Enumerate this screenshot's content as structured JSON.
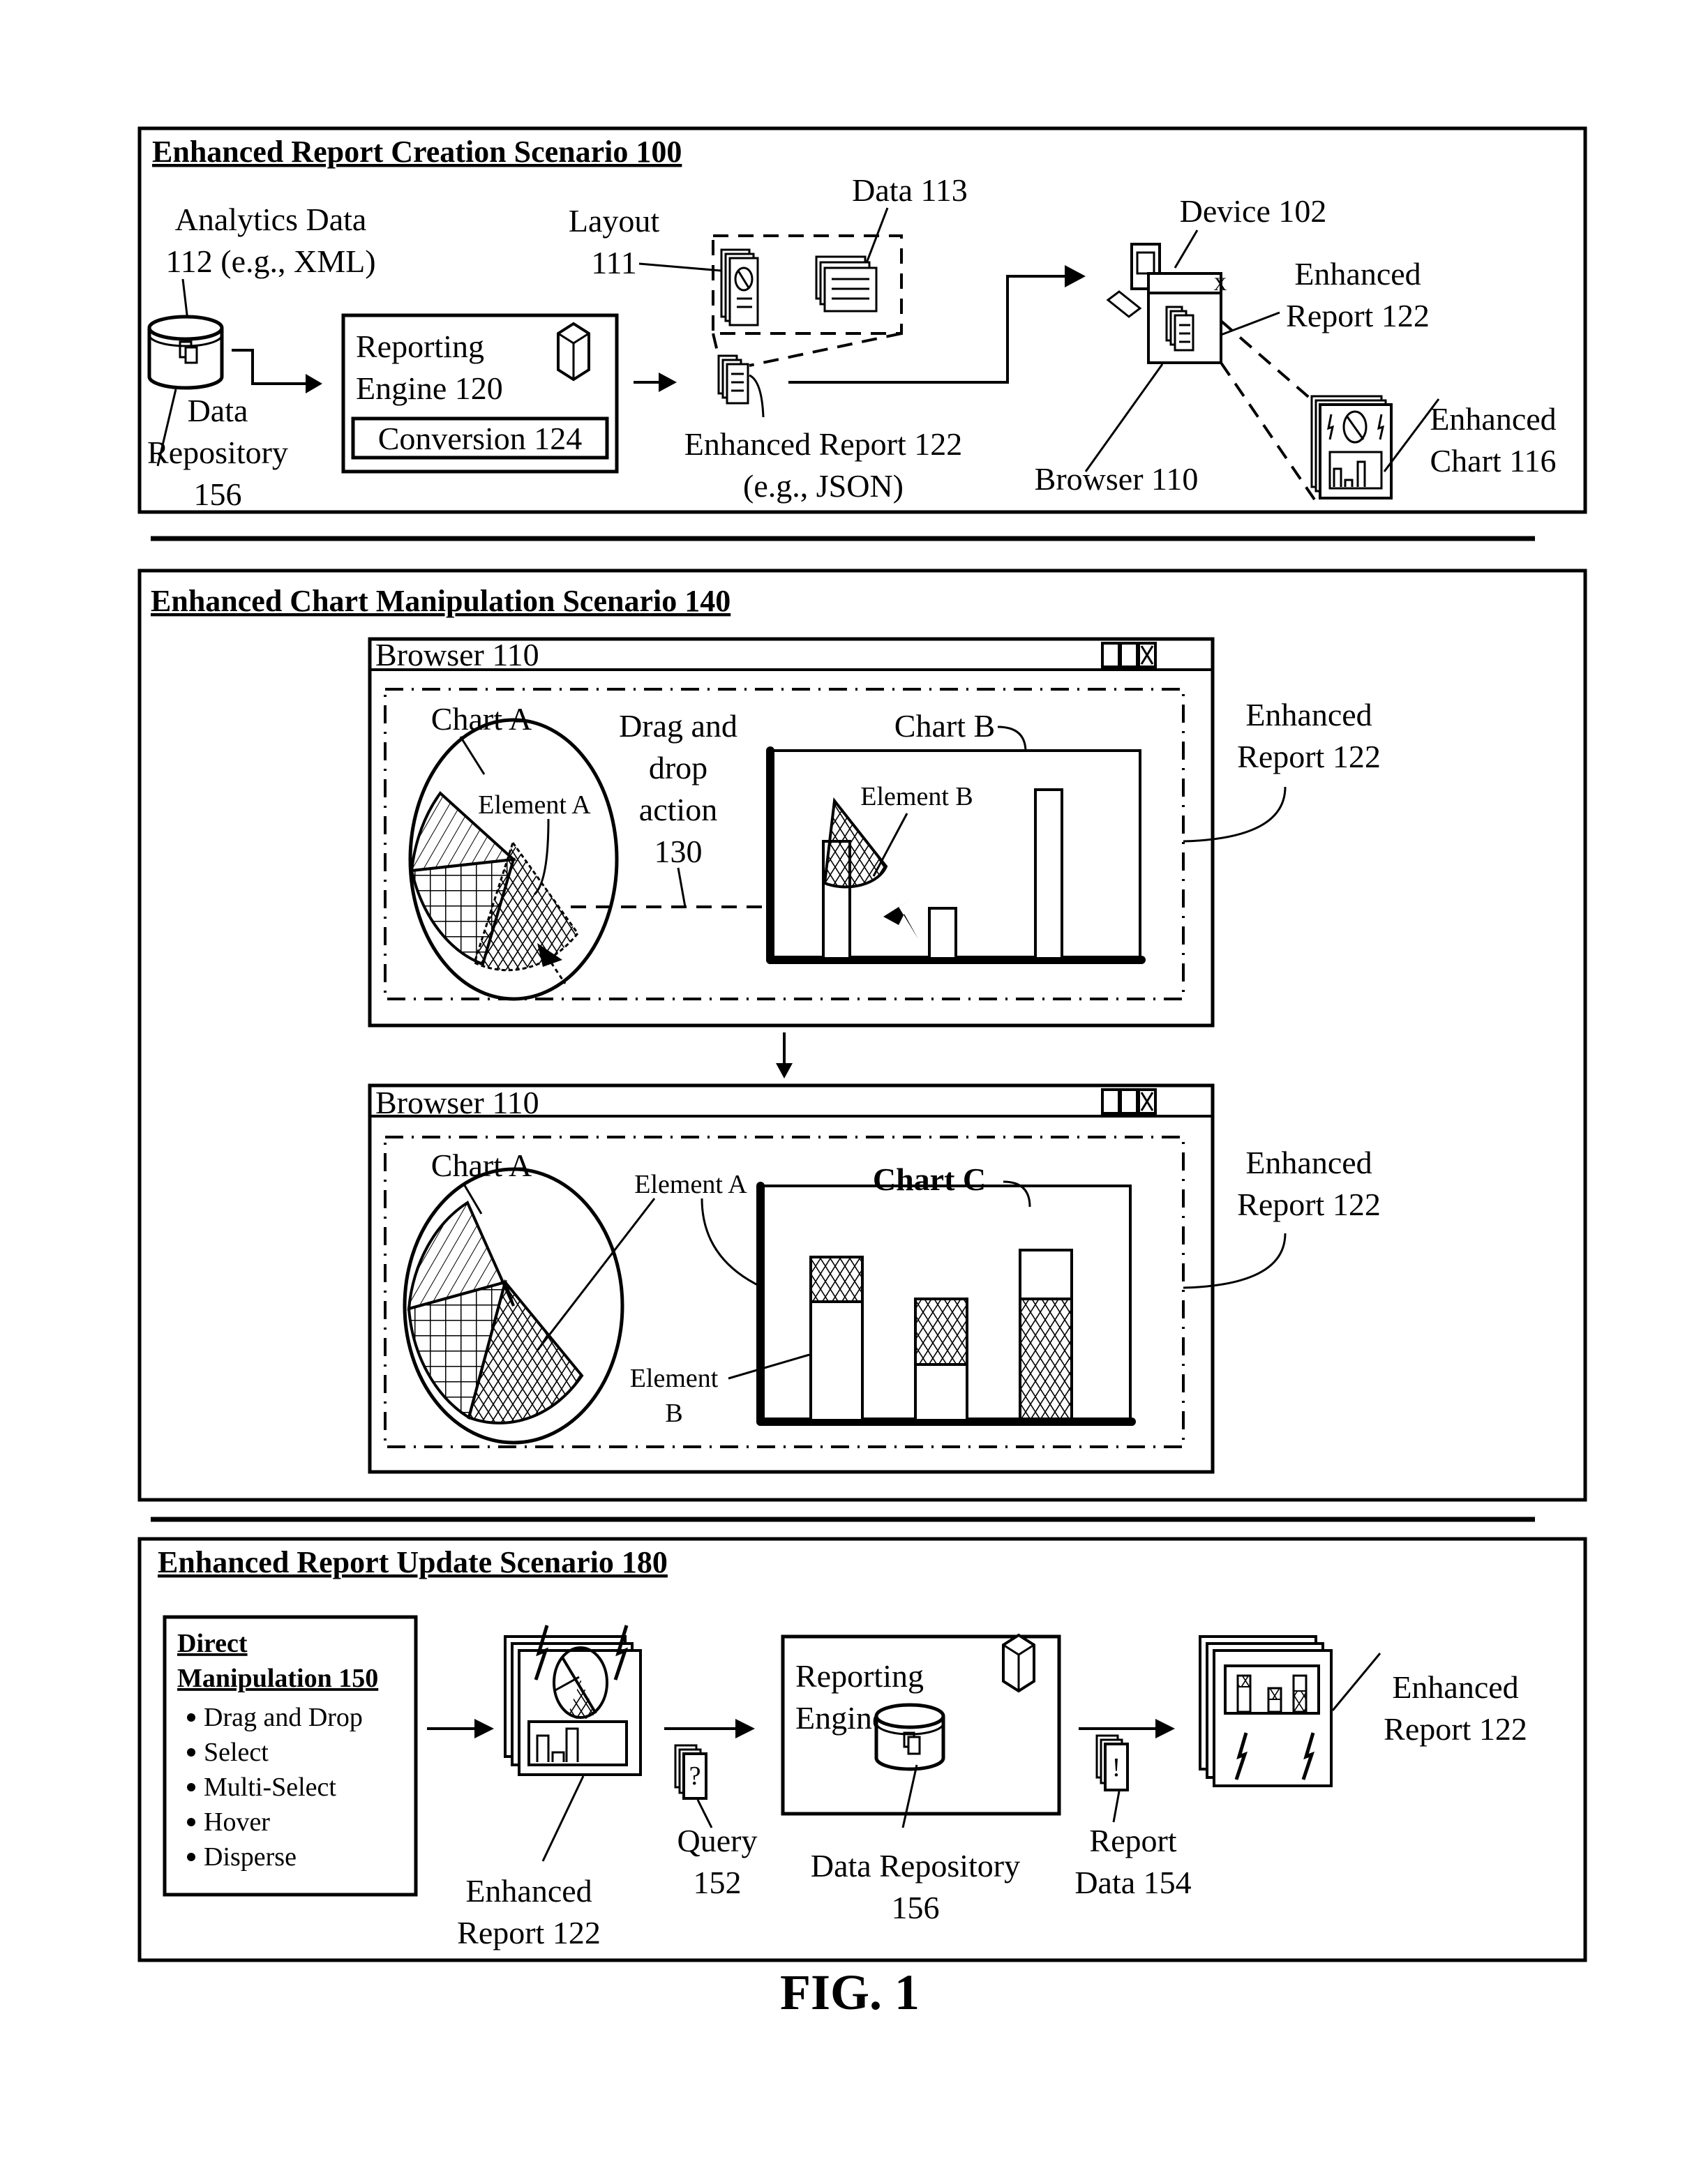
{
  "figure_label": "FIG. 1",
  "panel_creation": {
    "title": "Enhanced Report Creation Scenario 100",
    "analytics_data": [
      "Analytics Data",
      "112 (e.g., XML)"
    ],
    "data_repository": [
      "Data",
      "Repository",
      "156"
    ],
    "reporting_engine": [
      "Reporting",
      "Engine 120"
    ],
    "conversion": "Conversion 124",
    "layout": [
      "Layout",
      "111"
    ],
    "data_113": "Data 113",
    "enhanced_report": [
      "Enhanced Report 122",
      "(e.g., JSON)"
    ],
    "device": "Device 102",
    "enhanced_report_right": [
      "Enhanced",
      "Report 122"
    ],
    "browser": "Browser 110",
    "enhanced_chart": [
      "Enhanced",
      "Chart 116"
    ],
    "window_controls": "_ X"
  },
  "panel_manipulation": {
    "title": "Enhanced Chart Manipulation Scenario 140",
    "browser_before": {
      "title": "Browser 110",
      "chart_a": "Chart A",
      "element_a": "Element A",
      "drag_label": [
        "Drag and",
        "drop",
        "action",
        "130"
      ],
      "chart_b": "Chart B",
      "element_b": "Element B",
      "report_label": [
        "Enhanced",
        "Report 122"
      ]
    },
    "browser_after": {
      "title": "Browser 110",
      "chart_a": "Chart A",
      "element_a": "Element A",
      "chart_c": "Chart C",
      "element_b": [
        "Element",
        "B"
      ],
      "report_label": [
        "Enhanced",
        "Report 122"
      ]
    }
  },
  "panel_update": {
    "title": "Enhanced Report Update Scenario 180",
    "direct_manipulation": {
      "heading": [
        "Direct",
        "Manipulation 150"
      ],
      "items": [
        "Drag and Drop",
        "Select",
        "Multi-Select",
        "Hover",
        "Disperse"
      ]
    },
    "enhanced_report_left": [
      "Enhanced",
      "Report 122"
    ],
    "query": [
      "Query",
      "152"
    ],
    "query_glyph": "?",
    "reporting_engine": [
      "Reporting",
      "Engine 120"
    ],
    "data_repository": [
      "Data Repository",
      "156"
    ],
    "report_data": [
      "Report",
      "Data 154"
    ],
    "report_data_glyph": "!",
    "enhanced_report_right": [
      "Enhanced",
      "Report 122"
    ]
  }
}
